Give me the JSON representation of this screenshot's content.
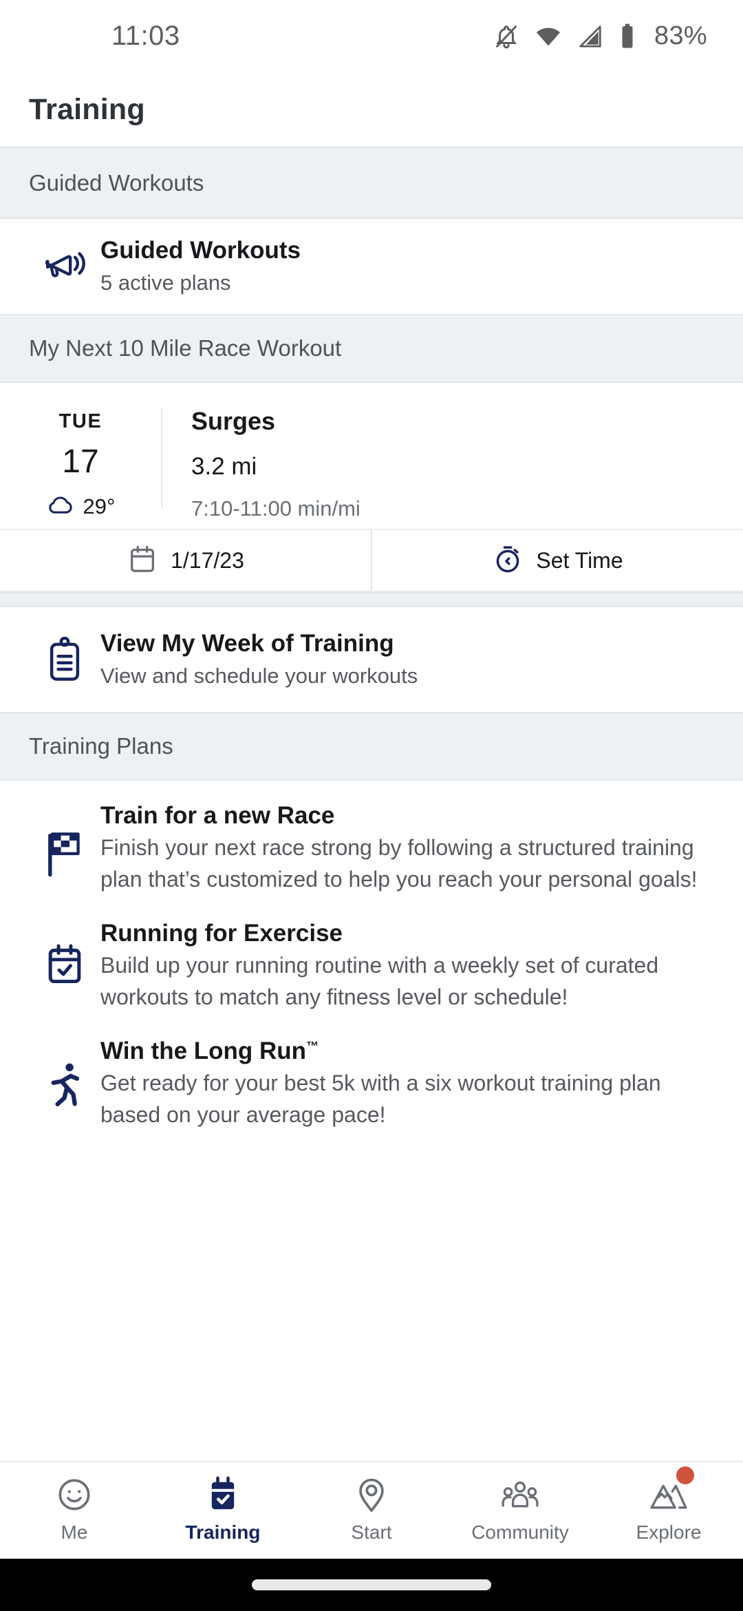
{
  "status_bar": {
    "time": "11:03",
    "battery_percent": "83%",
    "icons": [
      "bell-off-icon",
      "wifi-icon",
      "cell-signal-icon",
      "battery-icon"
    ]
  },
  "header": {
    "title": "Training"
  },
  "sections": {
    "guided_workouts": {
      "label": "Guided Workouts",
      "row": {
        "icon": "megaphone-icon",
        "title": "Guided Workouts",
        "subtitle": "5 active plans"
      }
    },
    "next_workout": {
      "label": "My Next 10 Mile Race Workout",
      "card": {
        "day_of_week": "TUE",
        "day_number": "17",
        "weather_icon": "cloud-icon",
        "temperature": "29°",
        "workout_name": "Surges",
        "distance": "3.2 mi",
        "pace_range": "7:10-11:00 min/mi"
      },
      "actions": [
        {
          "icon": "calendar-icon",
          "label": "1/17/23"
        },
        {
          "icon": "stopwatch-icon",
          "label": "Set Time"
        }
      ]
    },
    "view_week": {
      "icon": "clipboard-icon",
      "title": "View My Week of Training",
      "subtitle": "View and schedule your workouts"
    },
    "training_plans": {
      "label": "Training Plans",
      "plans": [
        {
          "icon": "checkered-flag-icon",
          "title": "Train for a new Race",
          "trademark": "",
          "description": "Finish your next race strong by following a structured training plan that’s customized to help you reach your personal goals!"
        },
        {
          "icon": "calendar-check-icon",
          "title": "Running for Exercise",
          "trademark": "",
          "description": "Build up your running routine with a weekly set of curated workouts to match any fitness level or schedule!"
        },
        {
          "icon": "runner-icon",
          "title": "Win the Long Run",
          "trademark": "™",
          "description": "Get ready for your best 5k with a six workout training plan based on your average pace!"
        }
      ]
    }
  },
  "bottom_nav": {
    "items": [
      {
        "icon": "smiley-face-icon",
        "label": "Me",
        "active": false,
        "badge": false
      },
      {
        "icon": "calendar-check-filled-icon",
        "label": "Training",
        "active": true,
        "badge": false
      },
      {
        "icon": "location-pin-icon",
        "label": "Start",
        "active": false,
        "badge": false
      },
      {
        "icon": "people-group-icon",
        "label": "Community",
        "active": false,
        "badge": false
      },
      {
        "icon": "mountains-icon",
        "label": "Explore",
        "active": false,
        "badge": true
      }
    ]
  },
  "colors": {
    "brand_navy": "#17255e",
    "section_bg": "#edf1f4",
    "badge_red": "#d0533d",
    "muted_text": "#55595e"
  }
}
